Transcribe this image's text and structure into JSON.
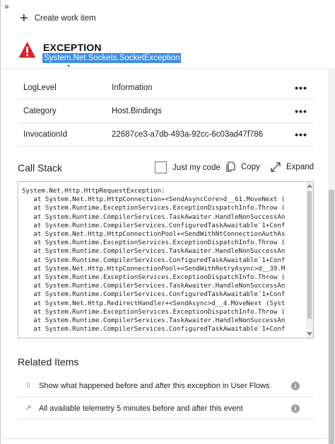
{
  "toolbar": {
    "collapse": "»",
    "create_label": "Create work item",
    "create_icon": "plus-icon"
  },
  "exception": {
    "title": "EXCEPTION",
    "type": "System.Net.Sockets.SocketException",
    "icon": "warning-icon",
    "color": "#d9232a",
    "highlight": "#3c8ee8"
  },
  "properties": [
    {
      "key": "LogLevel",
      "value": "Information"
    },
    {
      "key": "Category",
      "value": "Host.Bindings"
    },
    {
      "key": "InvocationId",
      "value": "22687ce3-a7db-493a-92cc-6c03ad47f786"
    }
  ],
  "more_label": "•••",
  "call_stack": {
    "title": "Call Stack",
    "just_my_code": "Just my code",
    "copy": "Copy",
    "expand": "Expand",
    "text": "System.Net.Http.HttpRequestException:\n   at System.Net.Http.HttpConnection+<SendAsyncCore>d__61.MoveNext (\n   at System.Runtime.ExceptionServices.ExceptionDispatchInfo.Throw (\n   at System.Runtime.CompilerServices.TaskAwaiter.HandleNonSuccessAn\n   at System.Runtime.CompilerServices.ConfiguredTaskAwaitable`1+Conf\n   at System.Net.Http.HttpConnectionPool+<SendWithNtConnectionAuthAs\n   at System.Runtime.ExceptionServices.ExceptionDispatchInfo.Throw (\n   at System.Runtime.CompilerServices.TaskAwaiter.HandleNonSuccessAn\n   at System.Runtime.CompilerServices.ConfiguredTaskAwaitable`1+Conf\n   at System.Net.Http.HttpConnectionPool+<SendWithRetryAsync>d__39.M\n   at System.Runtime.ExceptionServices.ExceptionDispatchInfo.Throw (\n   at System.Runtime.CompilerServices.TaskAwaiter.HandleNonSuccessAn\n   at System.Runtime.CompilerServices.ConfiguredTaskAwaitable`1+Conf\n   at System.Net.Http.RedirectHandler+<SendAsync>d__4.MoveNext (Syst\n   at System.Runtime.ExceptionServices.ExceptionDispatchInfo.Throw (\n   at System.Runtime.CompilerServices.TaskAwaiter.HandleNonSuccessAn\n   at System.Runtime.CompilerServices.ConfiguredTaskAwaitable`1+Conf"
  },
  "related": {
    "title": "Related Items",
    "items": [
      {
        "label": "Show what happened before and after this exception in User Flows",
        "icon": "user-flows-icon",
        "glyph": "⁞⁞"
      },
      {
        "label": "All available telemetry 5 minutes before and after this event",
        "icon": "telemetry-icon",
        "glyph": "↗"
      }
    ],
    "info_glyph": "i"
  }
}
